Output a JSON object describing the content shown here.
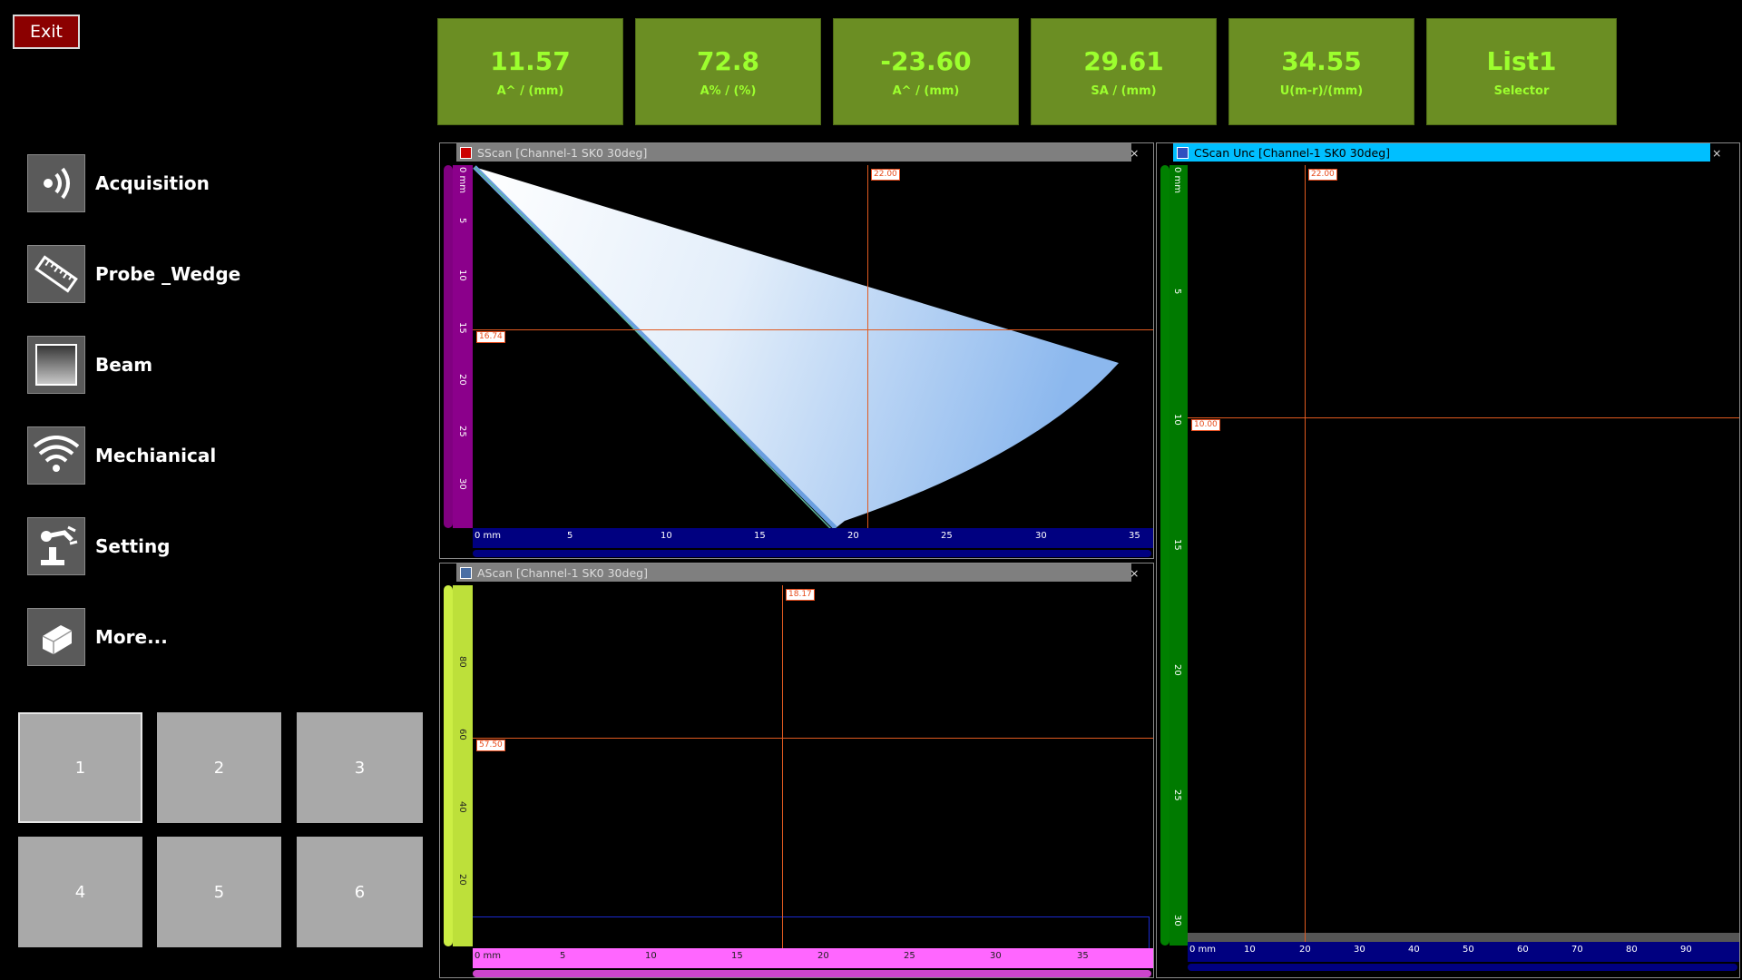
{
  "exit_label": "Exit",
  "readouts": [
    {
      "value": "11.57",
      "label": "A^ / (mm)"
    },
    {
      "value": "72.8",
      "label": "A% / (%)"
    },
    {
      "value": "-23.60",
      "label": "A^ / (mm)"
    },
    {
      "value": "29.61",
      "label": "SA / (mm)"
    },
    {
      "value": "34.55",
      "label": "U(m-r)/(mm)"
    },
    {
      "value": "List1",
      "label": "Selector"
    }
  ],
  "menu": [
    {
      "label": "Acquisition",
      "icon": "sound-wave-icon"
    },
    {
      "label": "Probe _Wedge",
      "icon": "probe-ruler-icon"
    },
    {
      "label": "Beam",
      "icon": "beam-square-icon"
    },
    {
      "label": "Mechianical",
      "icon": "wifi-arcs-icon"
    },
    {
      "label": "Setting",
      "icon": "robot-arm-icon"
    },
    {
      "label": "More...",
      "icon": "cube-icon"
    }
  ],
  "layout_buttons": [
    "1",
    "2",
    "3",
    "4",
    "5",
    "6"
  ],
  "active_layout": "1",
  "sscan": {
    "title": "SScan [Channel-1 SK0 30deg]",
    "close": "×",
    "cursor_x_label": "22.00",
    "cursor_y_label": "16.74",
    "x_ticks": [
      "0 mm",
      "5",
      "10",
      "15",
      "20",
      "25",
      "30",
      "35"
    ],
    "y_ticks": [
      "0 mm",
      "5",
      "10",
      "15",
      "20",
      "25",
      "30"
    ],
    "colors": {
      "left_bar": "#800080",
      "bottom_bar": "#000080"
    }
  },
  "ascan": {
    "title": "AScan [Channel-1 SK0 30deg]",
    "close": "×",
    "cursor_x_label": "18.17",
    "cursor_y_label": "57.50",
    "x_ticks": [
      "0 mm",
      "5",
      "10",
      "15",
      "20",
      "25",
      "30",
      "35"
    ],
    "y_ticks": [
      "80",
      "60",
      "40",
      "20"
    ],
    "colors": {
      "left_bar": "#ccee44",
      "bottom_bar": "#ff66ff"
    }
  },
  "cscan": {
    "title": "CScan Unc [Channel-1 SK0 30deg]",
    "close": "×",
    "cursor_x_label": "22.00",
    "cursor_y_label": "10.00",
    "x_ticks": [
      "0 mm",
      "10",
      "20",
      "30",
      "40",
      "50",
      "60",
      "70",
      "80",
      "90"
    ],
    "y_ticks": [
      "0 mm",
      "5",
      "10",
      "15",
      "20",
      "25",
      "30"
    ],
    "colors": {
      "title_bar": "#00bfff",
      "left_bar": "#008000",
      "bottom_bar": "#000080"
    }
  }
}
